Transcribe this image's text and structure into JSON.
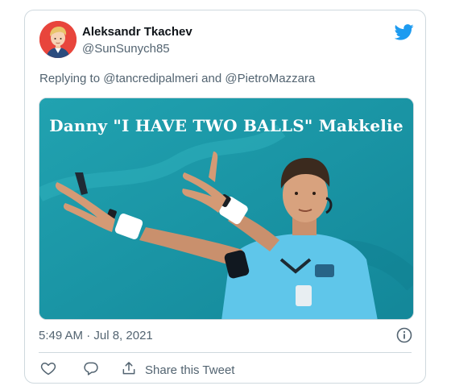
{
  "tweet": {
    "author": {
      "display_name": "Aleksandr Tkachev",
      "handle": "@SunSunych85"
    },
    "reply_prefix": "Replying to ",
    "reply_to": [
      "@tancredipalmeri",
      "@PietroMazzara"
    ],
    "reply_joiner": " and ",
    "media": {
      "title": "Danny \"I HAVE TWO BALLS\" Makkelie"
    },
    "timestamp": "5:49 AM · Jul 8, 2021",
    "actions": {
      "share_label": "Share this Tweet"
    }
  },
  "colors": {
    "brand": "#1d9bf0",
    "secondary_text": "#536471",
    "border": "#cfd9de",
    "media_background": "#1a93a3"
  },
  "icons": {
    "logo": "twitter-bird-icon",
    "info": "info-icon",
    "like": "heart-icon",
    "reply": "reply-bubble-icon",
    "share": "share-icon"
  }
}
